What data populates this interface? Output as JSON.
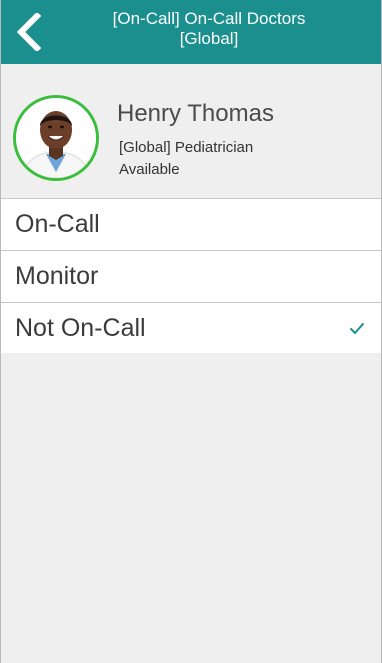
{
  "header": {
    "title_line1": "[On-Call] On-Call Doctors",
    "title_line2": "[Global]"
  },
  "profile": {
    "name": "Henry Thomas",
    "department": "[Global] Pediatrician",
    "availability": "Available"
  },
  "options": [
    {
      "label": "On-Call",
      "selected": false
    },
    {
      "label": "Monitor",
      "selected": false
    },
    {
      "label": "Not On-Call",
      "selected": true
    }
  ],
  "colors": {
    "header_bg": "#1a8f8d",
    "avatar_ring": "#3dbd3d",
    "check": "#1a8f8d"
  },
  "icons": {
    "back": "chevron-left-icon",
    "check": "checkmark-icon"
  }
}
